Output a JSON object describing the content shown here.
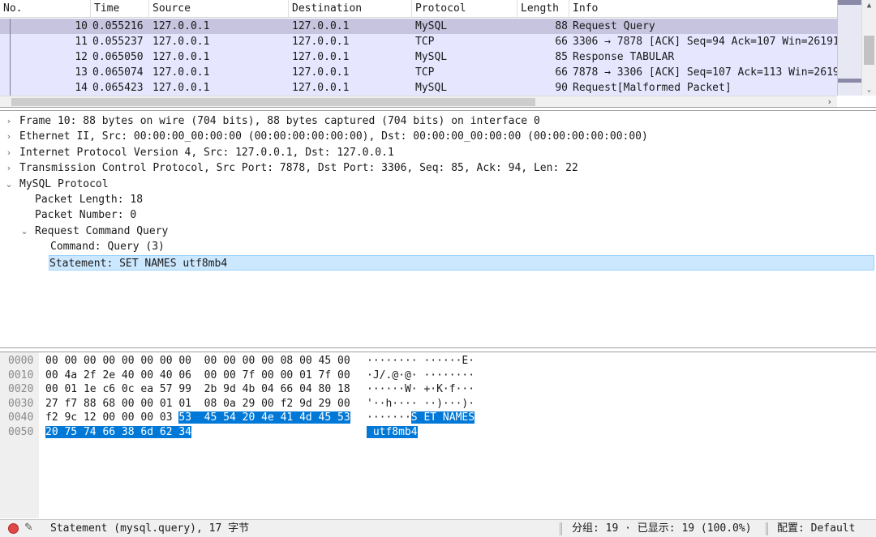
{
  "packet_list": {
    "columns": [
      "No.",
      "Time",
      "Source",
      "Destination",
      "Protocol",
      "Length",
      "Info"
    ],
    "rows": [
      {
        "no": "10",
        "time": "0.055216",
        "src": "127.0.0.1",
        "dst": "127.0.0.1",
        "proto": "MySQL",
        "len": "88",
        "info": "Request Query"
      },
      {
        "no": "11",
        "time": "0.055237",
        "src": "127.0.0.1",
        "dst": "127.0.0.1",
        "proto": "TCP",
        "len": "66",
        "info": "3306 → 7878 [ACK] Seq=94 Ack=107 Win=26191"
      },
      {
        "no": "12",
        "time": "0.065050",
        "src": "127.0.0.1",
        "dst": "127.0.0.1",
        "proto": "MySQL",
        "len": "85",
        "info": "Response TABULAR"
      },
      {
        "no": "13",
        "time": "0.065074",
        "src": "127.0.0.1",
        "dst": "127.0.0.1",
        "proto": "TCP",
        "len": "66",
        "info": "7878 → 3306 [ACK] Seq=107 Ack=113 Win=2619"
      },
      {
        "no": "14",
        "time": "0.065423",
        "src": "127.0.0.1",
        "dst": "127.0.0.1",
        "proto": "MySQL",
        "len": "90",
        "info": "Request[Malformed Packet]"
      }
    ],
    "row_color": "#e7e6ff",
    "selected_row_color": "#c7c4e0",
    "scroll_right_icon": "chevron-right-icon"
  },
  "details": {
    "items": [
      {
        "expander": "›",
        "text": "Frame 10: 88 bytes on wire (704 bits), 88 bytes captured (704 bits) on interface 0"
      },
      {
        "expander": "›",
        "text": "Ethernet II, Src: 00:00:00_00:00:00 (00:00:00:00:00:00), Dst: 00:00:00_00:00:00 (00:00:00:00:00:00)"
      },
      {
        "expander": "›",
        "text": "Internet Protocol Version 4, Src: 127.0.0.1, Dst: 127.0.0.1"
      },
      {
        "expander": "›",
        "text": "Transmission Control Protocol, Src Port: 7878, Dst Port: 3306, Seq: 85, Ack: 94, Len: 22"
      },
      {
        "expander": "⌄",
        "text": "MySQL Protocol"
      },
      {
        "expander": "",
        "text": "Packet Length: 18"
      },
      {
        "expander": "",
        "text": "Packet Number: 0"
      },
      {
        "expander": "⌄",
        "text": "Request Command Query"
      },
      {
        "expander": "",
        "text": "Command: Query (3)"
      },
      {
        "expander": "",
        "text": "Statement: SET NAMES utf8mb4"
      }
    ],
    "selection_color": "#cce8ff"
  },
  "bytes": {
    "rows": [
      {
        "offset": "0000",
        "hex": "00 00 00 00 00 00 00 00  00 00 00 00 08 00 45 00",
        "hex_hl": "",
        "ascii": "········ ······E·",
        "ascii_hl": ""
      },
      {
        "offset": "0010",
        "hex": "00 4a 2f 2e 40 00 40 06  00 00 7f 00 00 01 7f 00",
        "hex_hl": "",
        "ascii": "·J/.@·@· ········",
        "ascii_hl": ""
      },
      {
        "offset": "0020",
        "hex": "00 01 1e c6 0c ea 57 99  2b 9d 4b 04 66 04 80 18",
        "hex_hl": "",
        "ascii": "······W· +·K·f···",
        "ascii_hl": ""
      },
      {
        "offset": "0030",
        "hex": "27 f7 88 68 00 00 01 01  08 0a 29 00 f2 9d 29 00",
        "hex_hl": "",
        "ascii": "'··h···· ··)···)·",
        "ascii_hl": ""
      },
      {
        "offset": "0040",
        "hex": "f2 9c 12 00 00 00 03 ",
        "hex_hl": "53  45 54 20 4e 41 4d 45 53",
        "ascii": "·······",
        "ascii_hl": "S ET NAMES"
      },
      {
        "offset": "0050",
        "hex": "",
        "hex_hl": "20 75 74 66 38 6d 62 34",
        "ascii": "",
        "ascii_hl": " utf8mb4"
      }
    ],
    "highlight_color": "#0078d7"
  },
  "status": {
    "message": "Statement (mysql.query), 17 字节",
    "stats": "分组: 19 · 已显示: 19 (100.0%)",
    "profile": "配置: Default",
    "expert_icon": "red-circle-icon",
    "comment_icon": "edit-comment-icon"
  }
}
